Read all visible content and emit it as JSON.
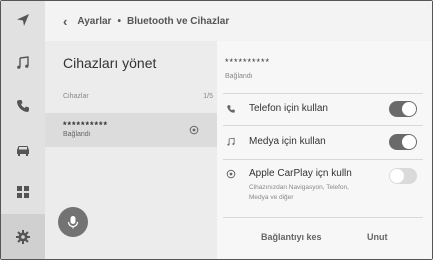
{
  "header": {
    "back_icon": "chevron-left-icon",
    "crumb_parent": "Ayarlar",
    "crumb_sep": "•",
    "crumb_current": "Bluetooth ve Cihazlar"
  },
  "rail": {
    "items": [
      "navigation-arrow-icon",
      "music-note-icon",
      "phone-icon",
      "car-icon",
      "apps-grid-icon",
      "gear-icon"
    ],
    "active_index": 5
  },
  "left_pane": {
    "title": "Cihazları yönet",
    "list_label": "Cihazlar",
    "list_count": "1/5",
    "device": {
      "name": "**********",
      "status": "Bağlandı",
      "icon": "bluetooth-connected-icon"
    },
    "mic_icon": "microphone-icon"
  },
  "right_pane": {
    "device_name": "**********",
    "device_status": "Bağlandı",
    "options": [
      {
        "icon": "phone-icon",
        "label": "Telefon için kullan",
        "enabled": true
      },
      {
        "icon": "music-note-icon",
        "label": "Medya için kullan",
        "enabled": true
      },
      {
        "icon": "carplay-icon",
        "label": "Apple CarPlay içn kulln",
        "sub": "Cihazınızdan Navigasyon, Telefon, Medya ve diğer",
        "enabled": false
      }
    ],
    "disconnect_label": "Bağlantıyı kes",
    "forget_label": "Unut"
  },
  "colors": {
    "rail_bg": "#e1e1e1",
    "toggle_on": "#6a6a6a",
    "toggle_off": "#dadada"
  }
}
